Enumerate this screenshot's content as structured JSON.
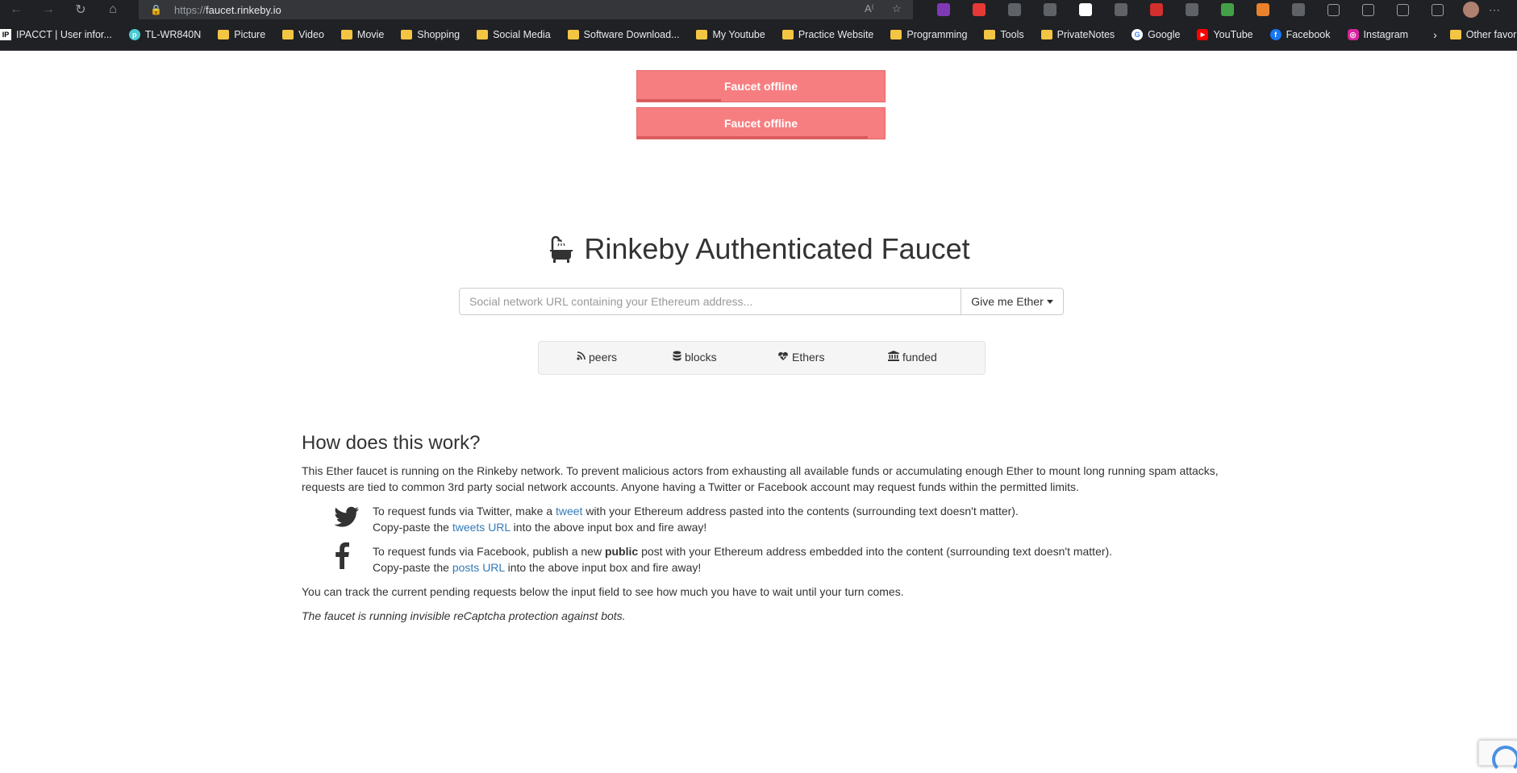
{
  "browser": {
    "url_scheme": "https://",
    "url_host": "faucet.rinkeby.io",
    "nav_icons": [
      "back-icon",
      "forward-icon",
      "reload-icon",
      "home-icon"
    ],
    "extension_colors": [
      "#7e3ab5",
      "#e53935",
      "#5f6368",
      "#5f6368",
      "#ffffff",
      "#5f6368",
      "#d32f2f",
      "#5f6368",
      "#43a047",
      "#e8822b",
      "#5f6368"
    ]
  },
  "bookmarks": [
    {
      "label": "IPACCT | User infor...",
      "icon": "ipacct-icon"
    },
    {
      "label": "TL-WR840N",
      "icon": "tplink-icon"
    },
    {
      "label": "Picture",
      "icon": "folder-icon"
    },
    {
      "label": "Video",
      "icon": "folder-icon"
    },
    {
      "label": "Movie",
      "icon": "folder-icon"
    },
    {
      "label": "Shopping",
      "icon": "folder-icon"
    },
    {
      "label": "Social Media",
      "icon": "folder-icon"
    },
    {
      "label": "Software Download...",
      "icon": "folder-icon"
    },
    {
      "label": "My Youtube",
      "icon": "folder-icon"
    },
    {
      "label": "Practice Website",
      "icon": "folder-icon"
    },
    {
      "label": "Programming",
      "icon": "folder-icon"
    },
    {
      "label": "Tools",
      "icon": "folder-icon"
    },
    {
      "label": "PrivateNotes",
      "icon": "folder-icon"
    },
    {
      "label": "Google",
      "icon": "google-icon"
    },
    {
      "label": "YouTube",
      "icon": "youtube-icon"
    },
    {
      "label": "Facebook",
      "icon": "facebook-icon"
    },
    {
      "label": "Instagram",
      "icon": "instagram-icon"
    }
  ],
  "bookmarks_other": "Other favorites",
  "offline_banners": [
    {
      "text": "Faucet offline",
      "progress": 0.34
    },
    {
      "text": "Faucet offline",
      "progress": 0.93
    }
  ],
  "title": "Rinkeby Authenticated Faucet",
  "search": {
    "placeholder": "Social network URL containing your Ethereum address...",
    "button": "Give me Ether"
  },
  "stats": [
    {
      "label": "peers",
      "icon": "rss-icon"
    },
    {
      "label": "blocks",
      "icon": "database-icon"
    },
    {
      "label": "Ethers",
      "icon": "heartbeat-icon"
    },
    {
      "label": "funded",
      "icon": "bank-icon"
    }
  ],
  "how": {
    "heading": "How does this work?",
    "intro": "This Ether faucet is running on the Rinkeby network. To prevent malicious actors from exhausting all available funds or accumulating enough Ether to mount long running spam attacks, requests are tied to common 3rd party social network accounts. Anyone having a Twitter or Facebook account may request funds within the permitted limits.",
    "twitter": {
      "a": "To request funds via Twitter, make a ",
      "link1": "tweet",
      "b": " with your Ethereum address pasted into the contents (surrounding text doesn't matter).",
      "c": "Copy-paste the ",
      "link2": "tweets URL",
      "d": " into the above input box and fire away!"
    },
    "facebook": {
      "a": "To request funds via Facebook, publish a new ",
      "bold": "public",
      "b": " post with your Ethereum address embedded into the content (surrounding text doesn't matter).",
      "c": "Copy-paste the ",
      "link2": "posts URL",
      "d": " into the above input box and fire away!"
    },
    "track": "You can track the current pending requests below the input field to see how much you have to wait until your turn comes.",
    "recaptcha": "The faucet is running invisible reCaptcha protection against bots."
  }
}
